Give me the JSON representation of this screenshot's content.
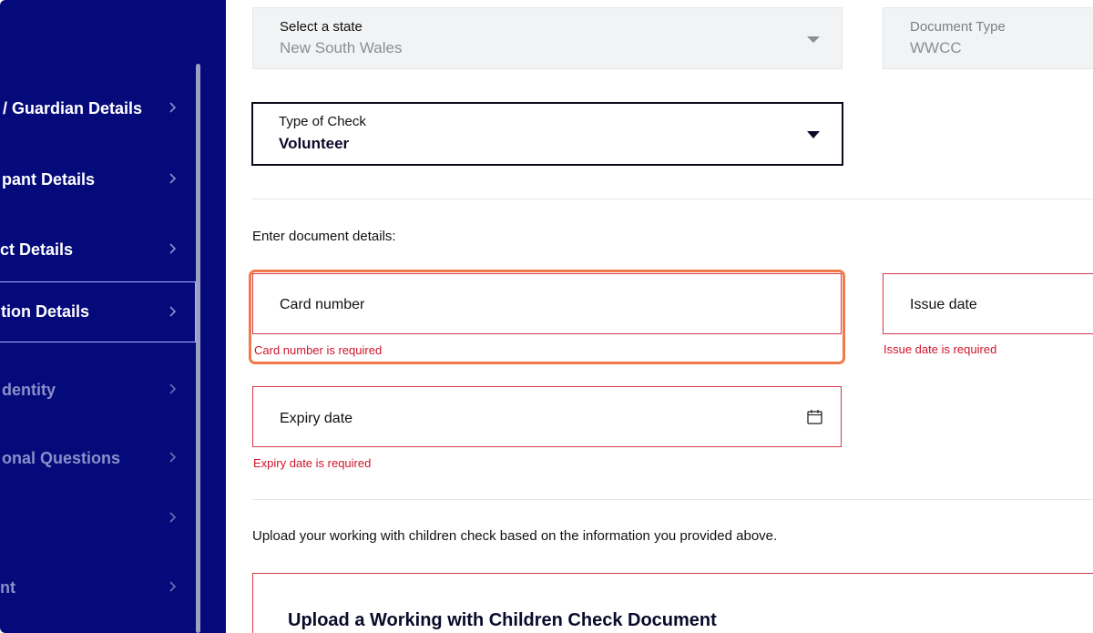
{
  "sidebar": {
    "items": [
      {
        "label": "/ Guardian Details",
        "state": "normal"
      },
      {
        "label": "pant Details",
        "state": "normal"
      },
      {
        "label": "ct Details",
        "state": "normal"
      },
      {
        "label": "tion Details",
        "state": "active"
      },
      {
        "label": "dentity",
        "state": "dim"
      },
      {
        "label": "onal Questions",
        "state": "dim"
      },
      {
        "label": "",
        "state": "dim"
      },
      {
        "label": "nt",
        "state": "dim"
      }
    ]
  },
  "state_select": {
    "label": "Select a state",
    "value": "New South Wales"
  },
  "document_type": {
    "label": "Document Type",
    "value": "WWCC"
  },
  "check_type": {
    "label": "Type of Check",
    "value": "Volunteer"
  },
  "details_heading": "Enter document details:",
  "card_number": {
    "placeholder": "Card number",
    "error": "Card number is required"
  },
  "issue_date": {
    "placeholder": "Issue date",
    "error": "Issue date is required"
  },
  "expiry_date": {
    "placeholder": "Expiry date",
    "error": "Expiry date is required"
  },
  "upload_instruction": "Upload your working with children check based on the information you provided above.",
  "upload_box": {
    "title": "Upload a Working with Children Check Document"
  },
  "colors": {
    "sidebar_bg": "#050a7a",
    "error": "#d0142a",
    "focus_ring": "#f07a4a"
  },
  "icons": {
    "chevron": "chevron-right-icon",
    "calendar": "calendar-icon",
    "dropdown": "caret-down-icon"
  }
}
